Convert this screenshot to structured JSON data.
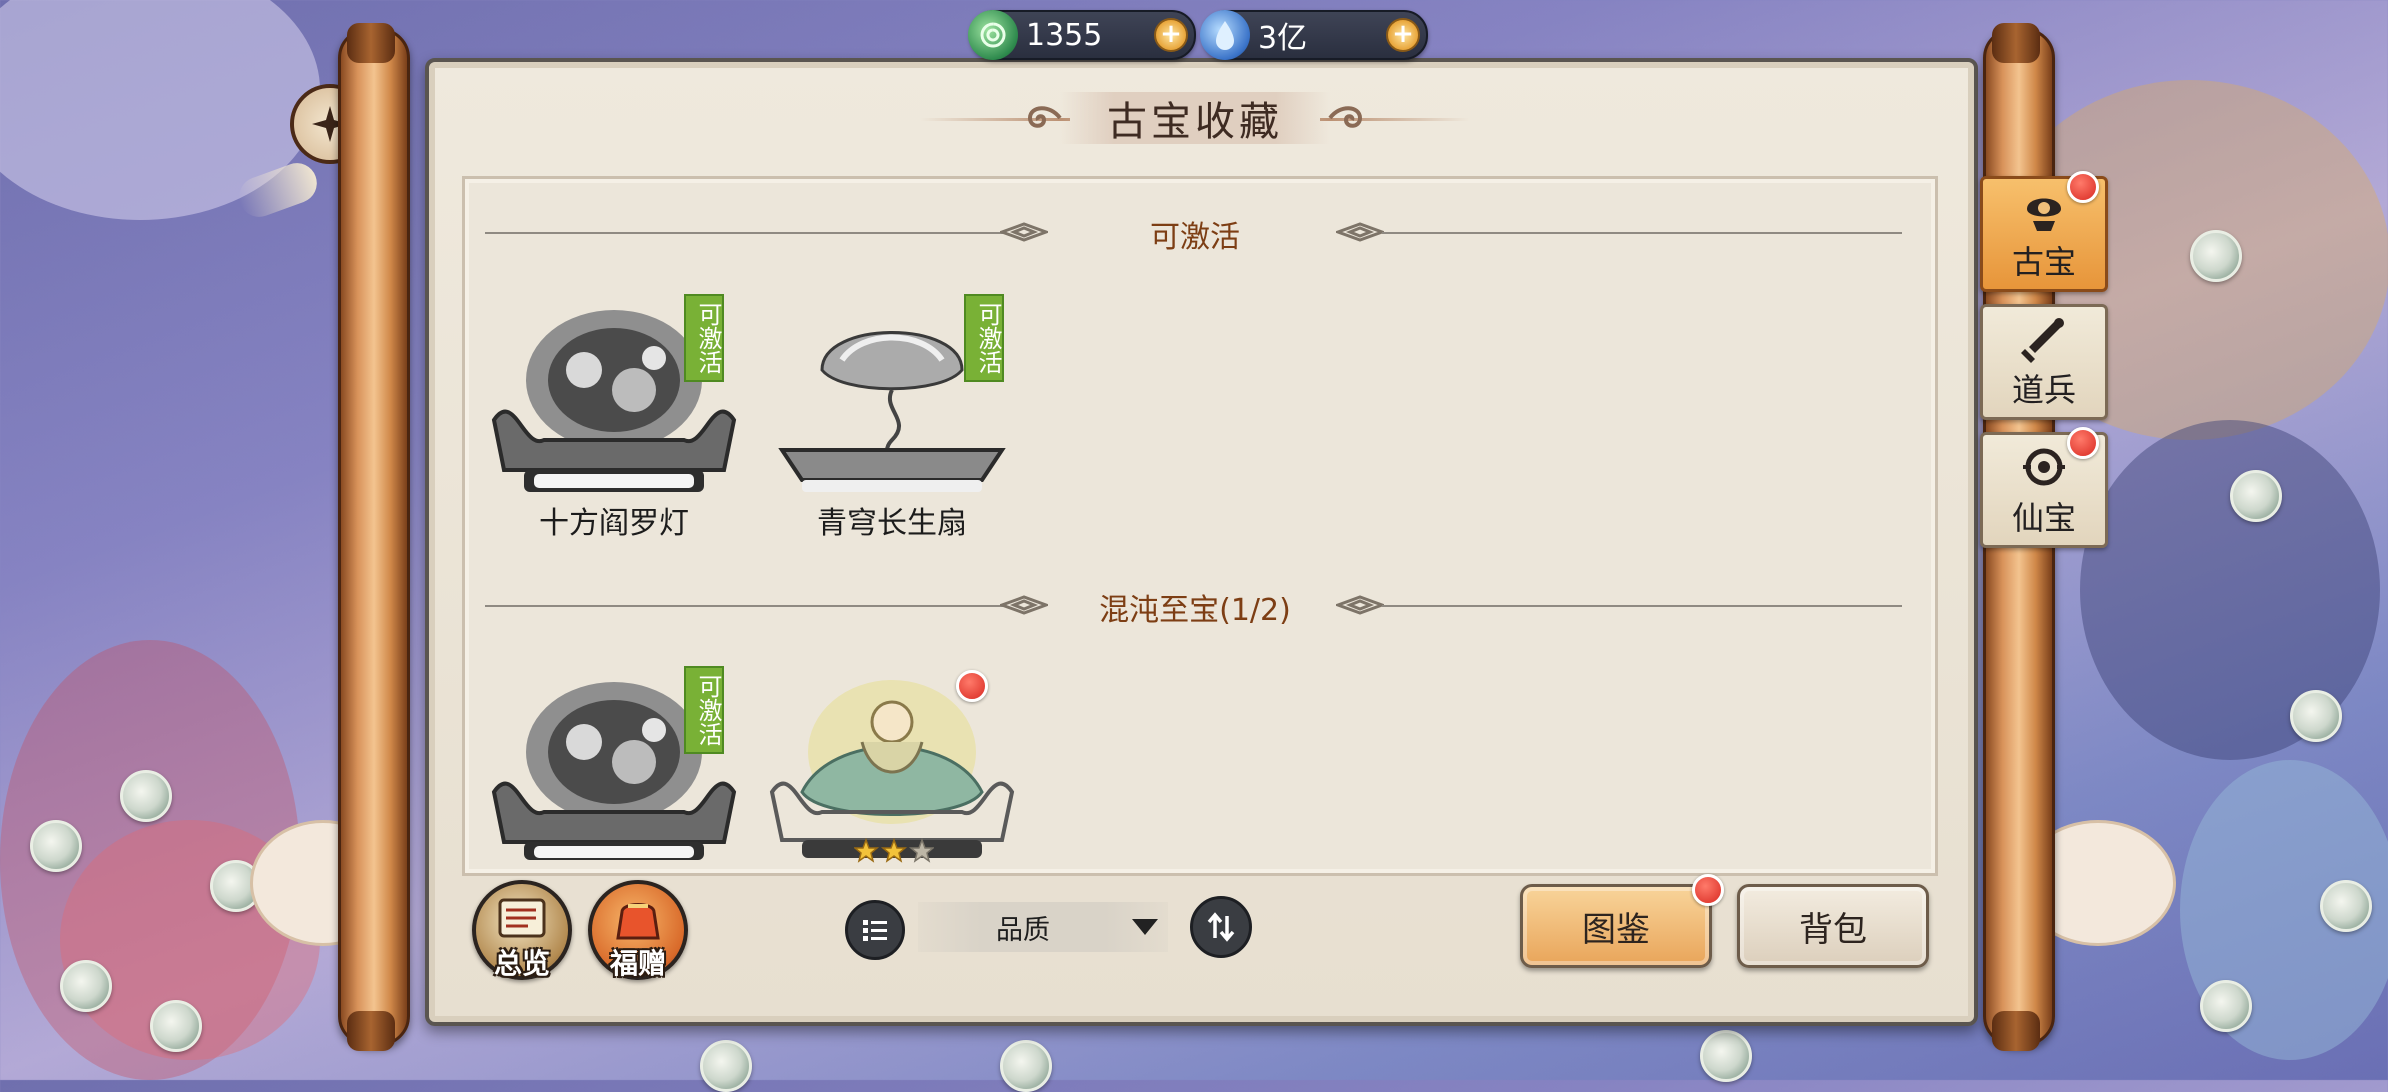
{
  "resources": [
    {
      "icon": "jade-coin-icon",
      "value": "1355"
    },
    {
      "icon": "spirit-crystal-icon",
      "value": "3亿"
    }
  ],
  "title": "古宝收藏",
  "sections": [
    {
      "title": "可激活"
    },
    {
      "title": "混沌至宝(1/2)"
    }
  ],
  "items": [
    {
      "name": "十方阎罗灯",
      "tag": "可激活"
    },
    {
      "name": "青穹长生扇",
      "tag": "可激活"
    },
    {
      "name": "",
      "tag": "可激活"
    },
    {
      "name": "",
      "tag": "",
      "stars": 2,
      "max_stars": 3
    }
  ],
  "side_tabs": [
    {
      "label": "古宝",
      "icon": "ancient-treasure-icon",
      "active": true
    },
    {
      "label": "道兵",
      "icon": "dao-weapon-icon",
      "active": false
    },
    {
      "label": "仙宝",
      "icon": "immortal-treasure-icon",
      "active": false
    }
  ],
  "bottom": {
    "overview_label": "总览",
    "gift_label": "福赠",
    "sort_value": "品质",
    "codex_label": "图鉴",
    "bag_label": "背包"
  },
  "colors": {
    "accent_green": "#79b136",
    "section_title": "#7d3e14",
    "notification_red": "#d82a22",
    "tab_active": "#e7953a"
  }
}
